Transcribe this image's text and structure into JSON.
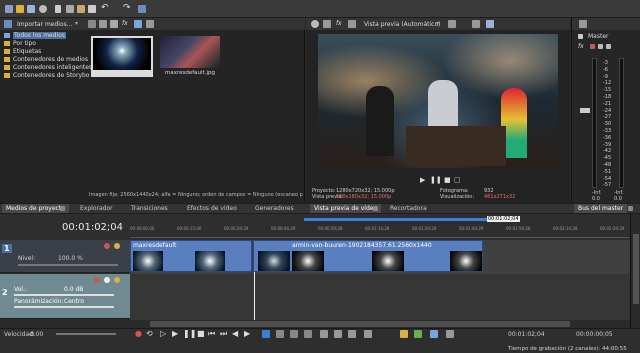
{
  "top_toolbar": {
    "icons": [
      "new-icon",
      "open-icon",
      "save-icon",
      "settings-icon",
      "cut-icon",
      "copy-icon",
      "paste-icon",
      "delete-icon",
      "undo-icon",
      "redo-icon",
      "tools-icon"
    ]
  },
  "media_panel": {
    "import_label": "Importar medios...",
    "tree": [
      {
        "label": "Todos los medios",
        "selected": true
      },
      {
        "label": "Por tipo"
      },
      {
        "label": "Etiquetas"
      },
      {
        "label": "Contenedores de medios"
      },
      {
        "label": "Contenedores inteligentes"
      },
      {
        "label": "Contenedores de Storybo"
      }
    ],
    "thumbnail_2_label": "maxresdefault.jpg",
    "status_text": "Imagen fija: 2560x1440x24; alfa = Ninguno; orden de campos = Ninguno (escaneo progr"
  },
  "preview": {
    "mode_label": "Vista previa (Automático)",
    "info": {
      "project_label": "Proyecto:",
      "project_value": "1280x720x32; 15.000p",
      "preview_label": "Vista previa:",
      "preview_value": "320x180x32; 15.000p",
      "display_label": "Visualización:",
      "display_value": "481x271x32",
      "frame_label": "Fotograma:",
      "frame_value": "932"
    }
  },
  "master": {
    "label": "Master",
    "ticks": [
      "3",
      "6",
      "9",
      "12",
      "15",
      "18",
      "21",
      "24",
      "27",
      "30",
      "33",
      "36",
      "39",
      "42",
      "45",
      "48",
      "51",
      "54",
      "57"
    ],
    "levels": [
      "-Inf.",
      "-Inf."
    ],
    "values": [
      "0.0",
      "0.0"
    ]
  },
  "tabs": {
    "left": [
      "Medios de proyecto",
      "Explorador",
      "Transiciones",
      "Efectos de vídeo",
      "Generadores"
    ],
    "middle": [
      "Vista previa de vídeo",
      "Recortadora"
    ],
    "right": "Bus del master"
  },
  "timeline": {
    "time_display": "00:01:02;04",
    "marker_time": "00:01:02;04",
    "ruler_labels": [
      "00:00:00;00",
      "00:00:15;00",
      "00:00:29;29",
      "00:00:44;29",
      "00:00:59;28",
      "00:01:14;28",
      "00:01:29;29",
      "00:01:44;29",
      "00:01:59;28",
      "00:02:14;28",
      "00:02:29;29"
    ],
    "video_track": {
      "number": "1",
      "level_label": "Nivel:",
      "level_value": "100.0 %"
    },
    "audio_track": {
      "number": "2",
      "vol_label": "Vol.:",
      "vol_value": "0.0 dB",
      "pan_label": "Panorámización:",
      "pan_value": "Centro"
    },
    "clips": [
      {
        "label": "maxresdefault"
      },
      {
        "label": "armin-van-buuren-1902184357.61.2560x1440"
      }
    ]
  },
  "transport": {
    "rate_label": "Velocidad:",
    "rate_value": "0.00",
    "current_time": "00:01:02;04",
    "end_time": "00:00:00;05",
    "record_time": "Tiempo de grabación (2 canales): 44:00:55"
  },
  "colors": {
    "accent": "#3c7fd6",
    "clip_video": "#5a7fc0",
    "folder": "#d8b23c",
    "audio_track": "#6f8a91",
    "marker": "#e05050"
  }
}
